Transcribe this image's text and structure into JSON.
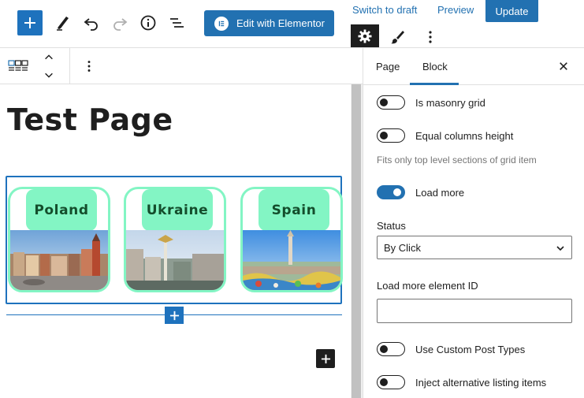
{
  "toolbar": {
    "add_icon": "plus-icon",
    "tools_icon": "pencil-icon",
    "undo_icon": "undo-icon",
    "redo_icon": "redo-icon",
    "details_icon": "info-icon",
    "list_view_icon": "list-view-icon",
    "elementor_label": "Edit with Elementor",
    "switch_draft_label": "Switch to draft",
    "preview_label": "Preview",
    "update_label": "Update",
    "settings_icon": "gear-icon",
    "styles_icon": "brush-icon",
    "options_icon": "more-vertical-icon"
  },
  "block_toolbar": {
    "block_icon": "listing-grid-icon",
    "move_up_icon": "chevron-up-icon",
    "move_down_icon": "chevron-down-icon",
    "options_icon": "more-vertical-icon"
  },
  "canvas": {
    "page_title": "Test Page",
    "cards": [
      {
        "label": "Poland"
      },
      {
        "label": "Ukraine"
      },
      {
        "label": "Spain"
      }
    ]
  },
  "sidebar": {
    "tabs": [
      {
        "label": "Page"
      },
      {
        "label": "Block"
      }
    ],
    "active_tab": "Block",
    "close_icon": "close-icon",
    "masonry_label": "Is masonry grid",
    "masonry_on": false,
    "equal_columns_label": "Equal columns height",
    "equal_columns_on": false,
    "equal_columns_help": "Fits only top level sections of grid item",
    "load_more_label": "Load more",
    "load_more_on": true,
    "status_label": "Status",
    "status_value": "By Click",
    "load_more_id_label": "Load more element ID",
    "load_more_id_value": "",
    "custom_post_types_label": "Use Custom Post Types",
    "custom_post_types_on": false,
    "inject_label": "Inject alternative listing items",
    "inject_on": false
  },
  "colors": {
    "accent": "#2271b1",
    "card_green": "#83f5c4",
    "card_text": "#144d2c",
    "dark": "#1e1e1e"
  }
}
